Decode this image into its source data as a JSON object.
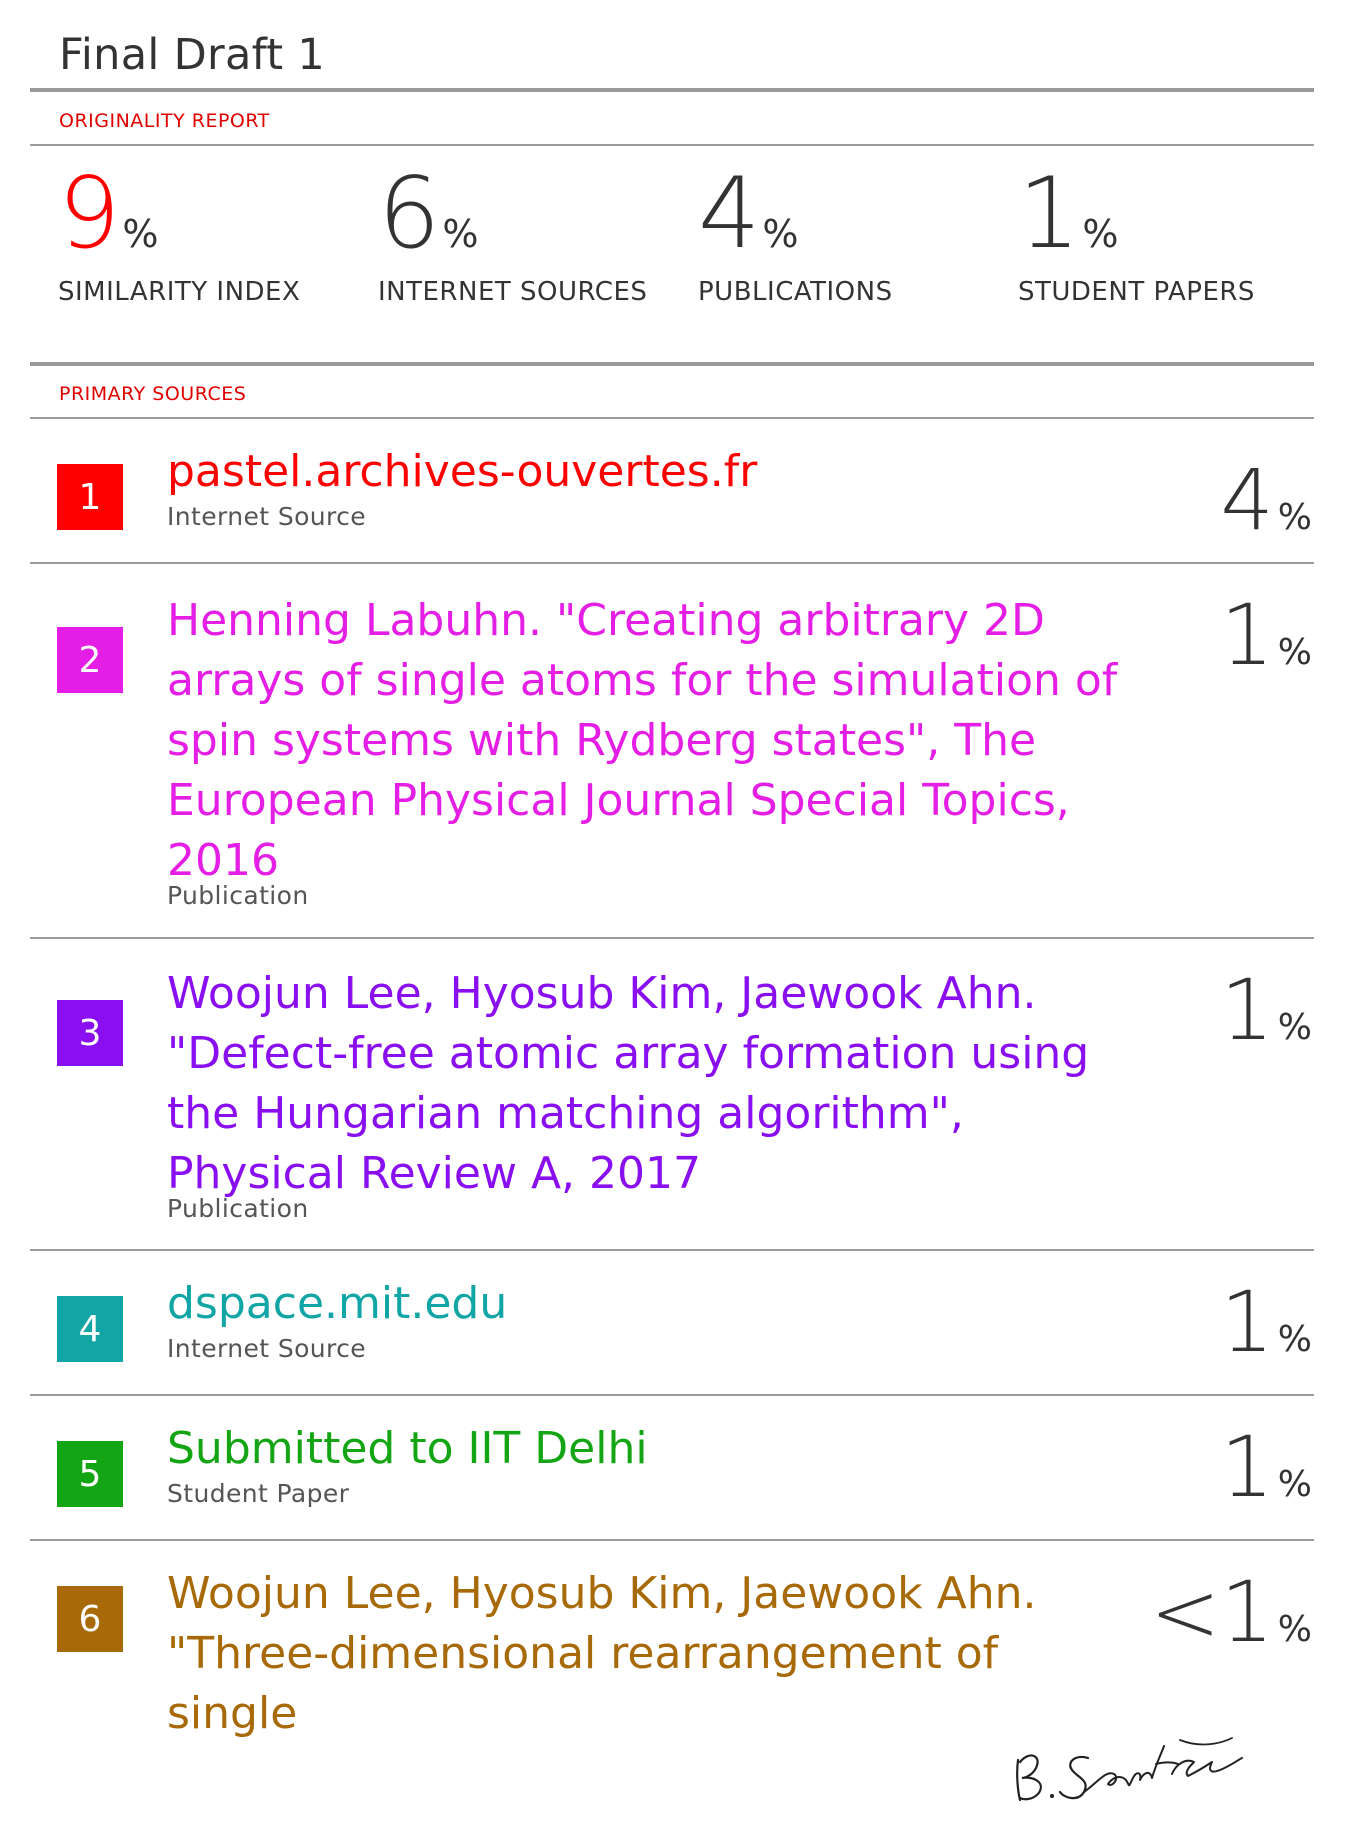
{
  "document": {
    "title": "Final Draft 1",
    "originality_label": "ORIGINALITY REPORT",
    "primary_sources_label": "PRIMARY SOURCES"
  },
  "stats": [
    {
      "value": "9",
      "unit": "%",
      "label": "SIMILARITY INDEX",
      "color": "#ff0000"
    },
    {
      "value": "6",
      "unit": "%",
      "label": "INTERNET SOURCES",
      "color": "#333333"
    },
    {
      "value": "4",
      "unit": "%",
      "label": "PUBLICATIONS",
      "color": "#333333"
    },
    {
      "value": "1",
      "unit": "%",
      "label": "STUDENT PAPERS",
      "color": "#333333"
    }
  ],
  "sources": [
    {
      "rank": "1",
      "title": "pastel.archives-ouvertes.fr",
      "type": "Internet Source",
      "percent": "4",
      "unit": "%",
      "color": "#ff0000"
    },
    {
      "rank": "2",
      "title": "Henning Labuhn. \"Creating arbitrary 2D arrays of single atoms for the simulation of spin systems with Rydberg states\", The European Physical Journal Special Topics, 2016",
      "type": "Publication",
      "percent": "1",
      "unit": "%",
      "color": "#e51ee5"
    },
    {
      "rank": "3",
      "title": "Woojun Lee, Hyosub Kim, Jaewook Ahn. \"Defect-free atomic array formation using the Hungarian matching algorithm\", Physical Review A, 2017",
      "type": "Publication",
      "percent": "1",
      "unit": "%",
      "color": "#8a0ff0"
    },
    {
      "rank": "4",
      "title": "dspace.mit.edu",
      "type": "Internet Source",
      "percent": "1",
      "unit": "%",
      "color": "#11a5a5"
    },
    {
      "rank": "5",
      "title": "Submitted to IIT Delhi",
      "type": "Student Paper",
      "percent": "1",
      "unit": "%",
      "color": "#14a514"
    },
    {
      "rank": "6",
      "title": "Woojun Lee, Hyosub Kim, Jaewook Ahn. \"Three-dimensional rearrangement of single",
      "type": "",
      "percent": "<1",
      "unit": "%",
      "color": "#a86a08"
    }
  ],
  "signature_text": "B. Santra"
}
